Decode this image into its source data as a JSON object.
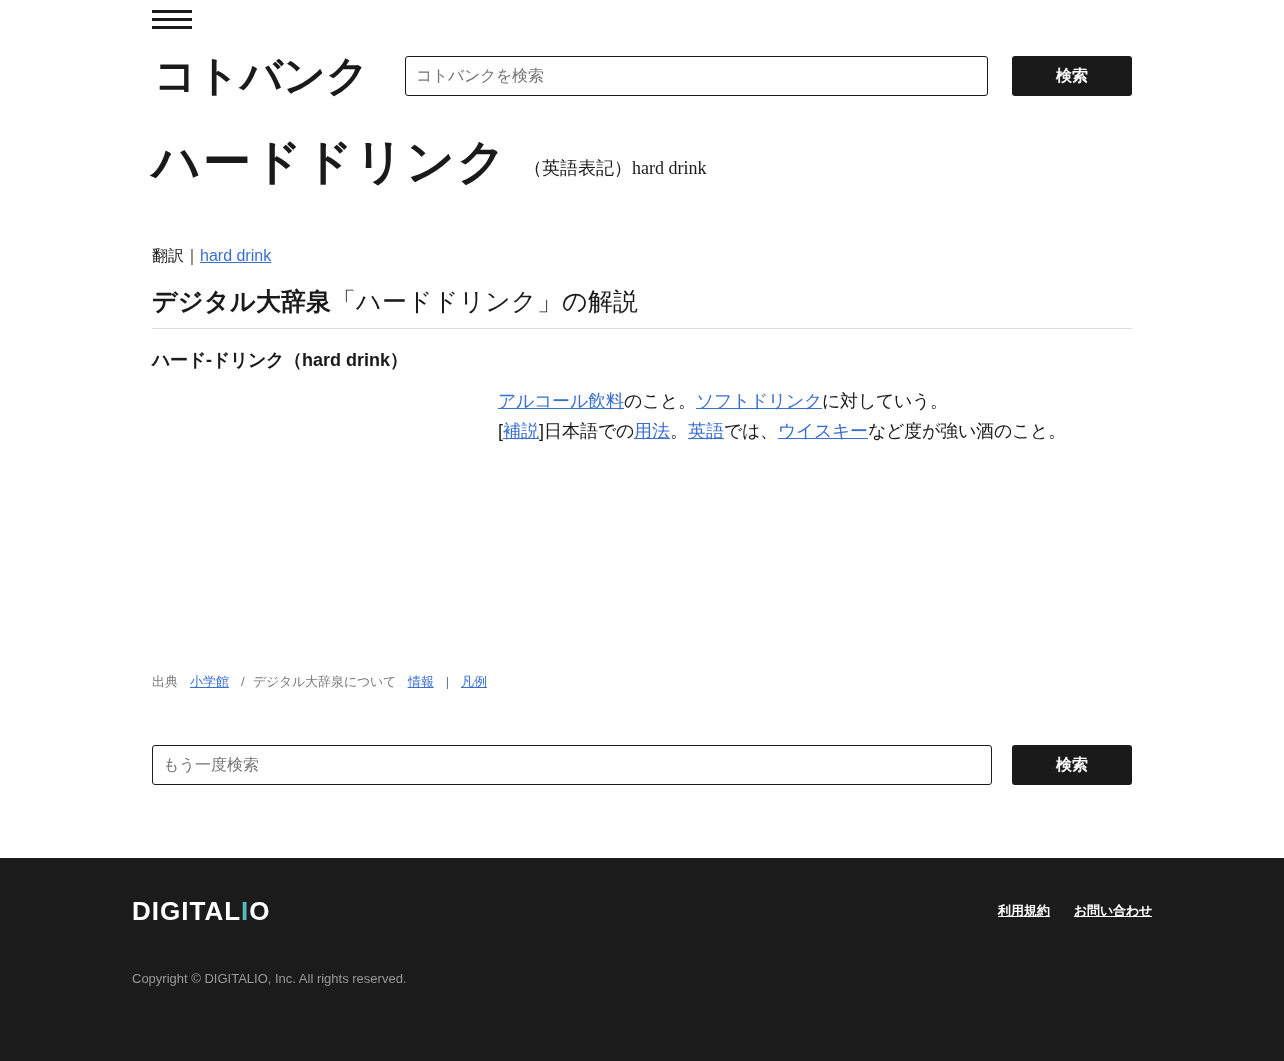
{
  "header": {
    "logo": "コトバンク",
    "search": {
      "placeholder": "コトバンクを検索"
    },
    "search_button": "検索"
  },
  "entry": {
    "title": "ハードドリンク",
    "english_note": "（英語表記）hard drink"
  },
  "translation": {
    "label": "翻訳｜",
    "link": "hard drink"
  },
  "section": {
    "heading": "**デジタル大辞泉**「ハードドリンク」の解説",
    "headword": "ハード‐ドリンク（hard drink）",
    "lines": [
      [
        {
          "kind": "link",
          "text": "アルコール飲料"
        },
        {
          "kind": "text",
          "text": "のこと。"
        },
        {
          "kind": "link",
          "text": "ソフトドリンク"
        },
        {
          "kind": "text",
          "text": "に対していう。"
        }
      ],
      [
        {
          "kind": "text",
          "text": "["
        },
        {
          "kind": "link",
          "text": "補説"
        },
        {
          "kind": "text",
          "text": "]日本語での"
        },
        {
          "kind": "link",
          "text": "用法"
        },
        {
          "kind": "text",
          "text": "。"
        },
        {
          "kind": "link",
          "text": "英語"
        },
        {
          "kind": "text",
          "text": "では、"
        },
        {
          "kind": "link",
          "text": "ウイスキー"
        },
        {
          "kind": "text",
          "text": "など度が強い酒のこと。"
        }
      ]
    ]
  },
  "source": [
    {
      "kind": "text",
      "text": "出典"
    },
    {
      "kind": "link",
      "text": "小学館"
    },
    {
      "kind": "text",
      "text": "/"
    },
    {
      "kind": "text",
      "text": "デジタル大辞泉について"
    },
    {
      "kind": "link",
      "text": "情報"
    },
    {
      "kind": "text",
      "text": "|"
    },
    {
      "kind": "link",
      "text": "凡例"
    }
  ],
  "bottom_search": {
    "placeholder": "もう一度検索",
    "button": "検索"
  },
  "footer": {
    "logo": "DIGITALIO",
    "links": [
      "利用規約",
      "お問い合わせ"
    ],
    "copyright": "Copyright © DIGITALIO, Inc. All rights reserved."
  }
}
